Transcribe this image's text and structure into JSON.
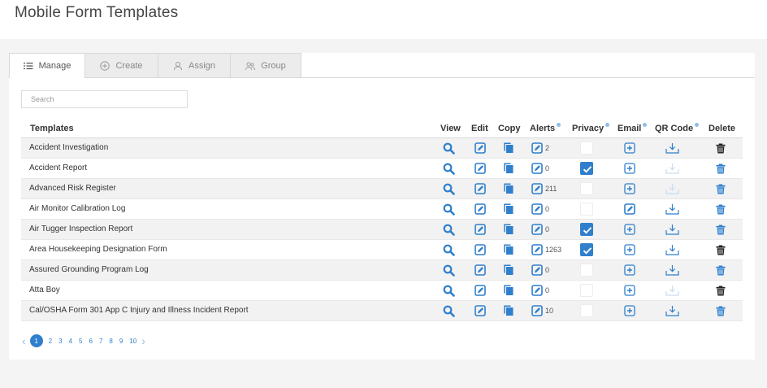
{
  "page": {
    "title": "Mobile Form Templates"
  },
  "tabs": [
    {
      "label": "Manage",
      "icon": "list-icon"
    },
    {
      "label": "Create",
      "icon": "plus-circle-icon"
    },
    {
      "label": "Assign",
      "icon": "user-icon"
    },
    {
      "label": "Group",
      "icon": "users-icon"
    }
  ],
  "search": {
    "placeholder": "Search",
    "value": ""
  },
  "table": {
    "columns": [
      "Templates",
      "View",
      "Edit",
      "Copy",
      "Alerts",
      "Privacy",
      "Email",
      "QR Code",
      "Delete"
    ],
    "rows": [
      {
        "name": "Accident Investigation",
        "alerts": "2",
        "privacy": false,
        "email": "plus",
        "qr_active": true,
        "delete_active": false
      },
      {
        "name": "Accident Report",
        "alerts": "0",
        "privacy": true,
        "email": "plus",
        "qr_active": false,
        "delete_active": true
      },
      {
        "name": "Advanced Risk Register",
        "alerts": "211",
        "privacy": false,
        "email": "plus",
        "qr_active": false,
        "delete_active": true
      },
      {
        "name": "Air Monitor Calibration Log",
        "alerts": "0",
        "privacy": false,
        "email": "edit",
        "qr_active": true,
        "delete_active": true
      },
      {
        "name": "Air Tugger Inspection Report",
        "alerts": "0",
        "privacy": true,
        "email": "plus",
        "qr_active": true,
        "delete_active": true
      },
      {
        "name": "Area Housekeeping Designation Form",
        "alerts": "1263",
        "privacy": true,
        "email": "plus",
        "qr_active": true,
        "delete_active": false
      },
      {
        "name": "Assured Grounding Program Log",
        "alerts": "0",
        "privacy": false,
        "email": "plus",
        "qr_active": true,
        "delete_active": true
      },
      {
        "name": "Atta Boy",
        "alerts": "0",
        "privacy": false,
        "email": "plus",
        "qr_active": false,
        "delete_active": false
      },
      {
        "name": "Cal/OSHA Form 301 App C Injury and Illness Incident Report",
        "alerts": "10",
        "privacy": false,
        "email": "plus",
        "qr_active": true,
        "delete_active": true
      }
    ]
  },
  "pagination": {
    "pages": [
      "1",
      "2",
      "3",
      "4",
      "5",
      "6",
      "7",
      "8",
      "9",
      "10"
    ],
    "current": "1"
  },
  "colors": {
    "accent": "#2f7fcc",
    "inactive": "#c9ddf0",
    "delete_dark": "#222222"
  }
}
